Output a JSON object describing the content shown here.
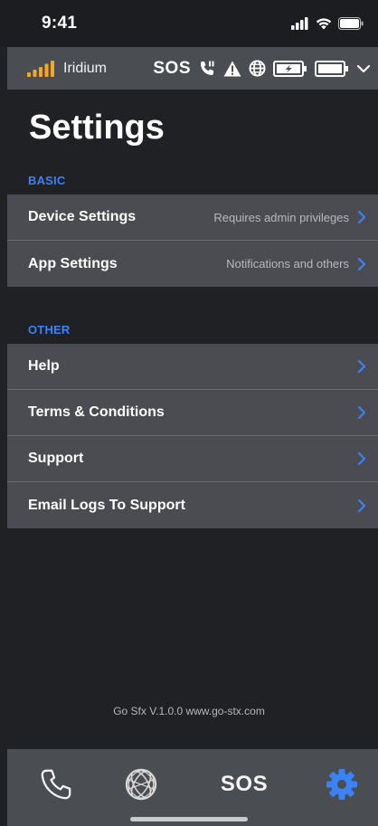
{
  "status_bar": {
    "time": "9:41"
  },
  "device_bar": {
    "network_name": "Iridium",
    "sos_label": "SOS"
  },
  "page": {
    "title": "Settings"
  },
  "sections": {
    "basic": {
      "header": "BASIC",
      "items": [
        {
          "label": "Device Settings",
          "detail": "Requires admin privileges"
        },
        {
          "label": "App Settings",
          "detail": "Notifications and others"
        }
      ]
    },
    "other": {
      "header": "OTHER",
      "items": [
        {
          "label": "Help"
        },
        {
          "label": "Terms & Conditions"
        },
        {
          "label": "Support"
        },
        {
          "label": "Email Logs To Support"
        }
      ]
    }
  },
  "footer": {
    "version": "Go Sfx V.1.0.0 www.go-stx.com"
  },
  "tab_bar": {
    "sos_label": "SOS",
    "active_tab": "settings"
  },
  "icons": {
    "chevron": "chevron-right-icon",
    "signal": "signal-bars-icon",
    "wifi": "wifi-icon",
    "battery": "battery-icon",
    "phone": "phone-icon",
    "globe": "globe-icon",
    "gear": "gear-icon",
    "warning": "warning-icon"
  },
  "colors": {
    "accent": "#3b82f6",
    "signal_orange": "#f5a623",
    "background": "#1f2125",
    "bar": "#4a4d52"
  }
}
